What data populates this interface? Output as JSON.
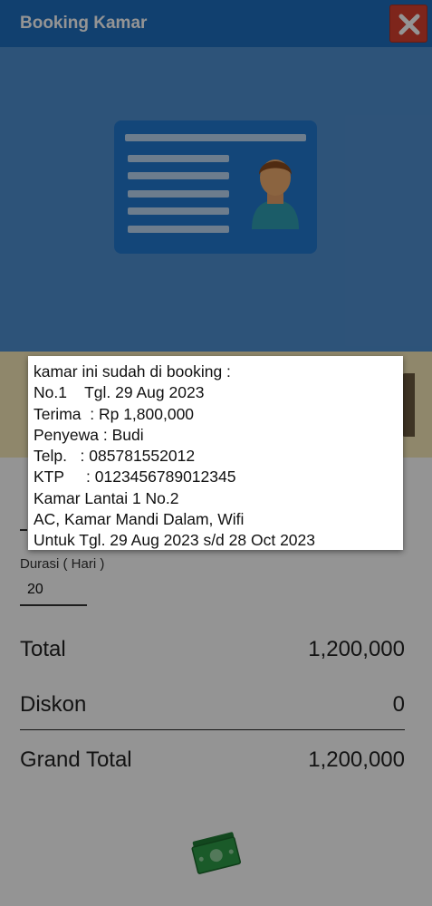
{
  "header": {
    "title": "Booking Kamar"
  },
  "form": {
    "duration_label": "Durasi ( Hari )",
    "duration_value": "20"
  },
  "summary": {
    "total_label": "Total",
    "total_value": "1,200,000",
    "discount_label": "Diskon",
    "discount_value": "0",
    "grand_total_label": "Grand Total",
    "grand_total_value": "1,200,000"
  },
  "toast": {
    "lines": [
      "kamar ini sudah di booking :",
      "No.1    Tgl. 29 Aug 2023",
      "Terima  : Rp 1,800,000",
      "Penyewa : Budi",
      "Telp.   : 085781552012",
      "KTP     : 0123456789012345",
      "Kamar Lantai 1 No.2",
      "AC, Kamar Mandi Dalam, Wifi",
      "Untuk Tgl. 29 Aug 2023 s/d 28 Oct 2023"
    ]
  },
  "icons": {
    "close": "close-icon",
    "id_card": "id-card-icon",
    "money": "money-icon"
  },
  "colors": {
    "header": "#1e6fc0",
    "close_button": "#d9412f",
    "banner": "#4f8fd0",
    "room_info": "#f6e8b9",
    "money_green": "#2e9b47"
  }
}
